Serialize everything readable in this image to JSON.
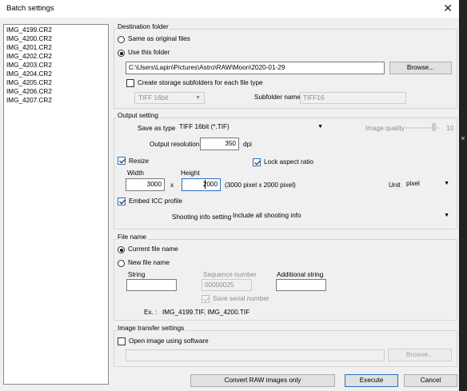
{
  "window": {
    "title": "Batch settings",
    "close_glyph": "✕"
  },
  "side_strip": {
    "close_glyph": "×"
  },
  "files": [
    "IMG_4199.CR2",
    "IMG_4200.CR2",
    "IMG_4201.CR2",
    "IMG_4202.CR2",
    "IMG_4203.CR2",
    "IMG_4204.CR2",
    "IMG_4205.CR2",
    "IMG_4206.CR2",
    "IMG_4207.CR2"
  ],
  "destination": {
    "title": "Destination folder",
    "same_as_original": "Same as original files",
    "use_this_folder": "Use this folder",
    "path": "C:\\Users\\Lapin\\Pictures\\Astro\\RAW\\Moon\\2020-01-29",
    "browse": "Browse...",
    "create_subfolders": "Create storage subfolders for each file type",
    "subfolder_type": "TIFF 16bit",
    "subfolder_name_label": "Subfolder name",
    "subfolder_name": "TIFF16"
  },
  "output": {
    "title": "Output setting",
    "save_as_label": "Save as type",
    "save_as_value": "TIFF 16bit (*.TIF)",
    "image_quality_label": "Image quality",
    "image_quality_value": "10",
    "resolution_label": "Output resolution",
    "resolution_value": "350",
    "resolution_unit": "dpi",
    "resize": "Resize",
    "lock_aspect": "Lock aspect ratio",
    "width_label": "Width",
    "height_label": "Height",
    "width": "3000",
    "times": "x",
    "height": "2000",
    "dimensions_note": "(3000 pixel x 2000 pixel)",
    "unit_label": "Unit",
    "unit_value": "pixel",
    "embed_icc": "Embed ICC profile",
    "shooting_info_label": "Shooting info setting",
    "shooting_info_value": "Include all shooting info"
  },
  "filename": {
    "title": "File name",
    "current": "Current file name",
    "new": "New file name",
    "string_label": "String",
    "string_value": "",
    "sequence_label": "Sequence number",
    "sequence_value": "00000025",
    "save_serial": "Save serial number",
    "additional_label": "Additional string",
    "additional_value": "",
    "example_label": "Ex. :",
    "example_value": "IMG_4199.TIF, IMG_4200.TIF"
  },
  "transfer": {
    "title": "Image transfer settings",
    "open_using": "Open image using software",
    "software_path": "",
    "browse": "Browse..."
  },
  "footer": {
    "convert_raw": "Convert RAW images only",
    "execute": "Execute",
    "cancel": "Cancel"
  },
  "arrow_glyph": "▼",
  "colors": {
    "accent": "#2b6fc2",
    "background": "#f0f0f0"
  }
}
